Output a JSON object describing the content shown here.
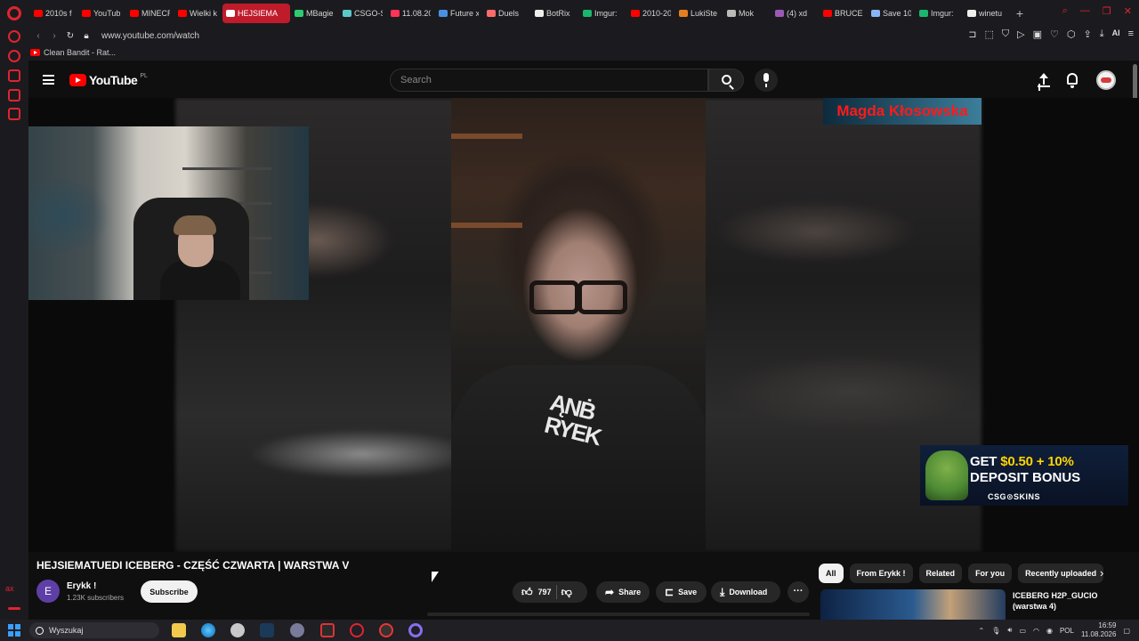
{
  "browser": {
    "tabs": [
      {
        "label": "2010s f",
        "color": "#ff0000"
      },
      {
        "label": "YouTub",
        "color": "#ff0000"
      },
      {
        "label": "MINECR",
        "color": "#ff0000"
      },
      {
        "label": "Wielki k",
        "color": "#ff0000"
      },
      {
        "label": "HEJSIEMA",
        "color": "#ffffff",
        "active": true
      },
      {
        "label": "MBagie",
        "color": "#2ecc71"
      },
      {
        "label": "CSGO-S",
        "color": "#5cc7c7"
      },
      {
        "label": "11.08.20",
        "color": "#ff3355"
      },
      {
        "label": "Future x",
        "color": "#4a90e2"
      },
      {
        "label": "Duels",
        "color": "#ff6b6b"
      },
      {
        "label": "BotRix",
        "color": "#eeeeee"
      },
      {
        "label": "Imgur:",
        "color": "#1bb76e"
      },
      {
        "label": "2010-20",
        "color": "#ff0000"
      },
      {
        "label": "LukiSte",
        "color": "#e67e22"
      },
      {
        "label": "Mok",
        "color": "#bbbbbb"
      },
      {
        "label": "(4) xd",
        "color": "#9b59b6"
      },
      {
        "label": "BRUCE",
        "color": "#ff0000"
      },
      {
        "label": "Save 10",
        "color": "#8ab4f8"
      },
      {
        "label": "Imgur:",
        "color": "#1bb76e"
      },
      {
        "label": "winetu",
        "color": "#eeeeee"
      }
    ],
    "url": "www.youtube.com/watch",
    "ai_label": "AI",
    "bookmark": "Clean Bandit - Rat...",
    "rail_label": "ax"
  },
  "youtube": {
    "logo_text": "YouTube",
    "country": "PL",
    "search_placeholder": "Search",
    "video": {
      "overlay_name": "Magda Kłosowska",
      "ad": {
        "line1_a": "GET ",
        "line1_b": "$0.50 + 10%",
        "line2": "DEPOSIT BONUS",
        "brand": "CSG⊙SKINS"
      }
    },
    "title": "HEJSIEMATUEDI ICEBERG - CZĘŚĆ CZWARTA | WARSTWA V",
    "channel": {
      "initial": "E",
      "name": "Erykk !",
      "subscribers": "1.23K subscribers",
      "subscribe_label": "Subscribe"
    },
    "actions": {
      "likes": "797",
      "share": "Share",
      "save": "Save",
      "download": "Download",
      "more": "···"
    },
    "chips": [
      "All",
      "From Erykk !",
      "Related",
      "For you",
      "Recently uploaded"
    ],
    "recommendation": {
      "title_line1": "ICEBERG H2P_GUCIO",
      "title_line2": "(warstwa 4)"
    }
  },
  "taskbar": {
    "search_placeholder": "Wyszukaj",
    "language": "POL",
    "time": "16:59",
    "date": "11.08.2026"
  }
}
